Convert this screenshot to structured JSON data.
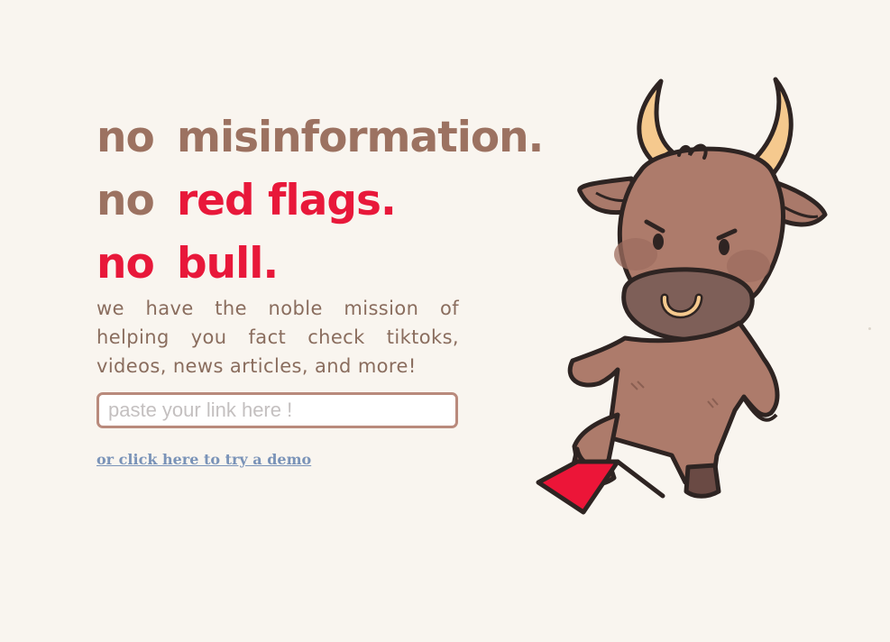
{
  "hero": {
    "line1": {
      "prefix": "no",
      "text": "misinformation."
    },
    "line2": {
      "prefix": "no",
      "text": "red flags."
    },
    "line3": {
      "prefix": "no",
      "text": "bull."
    },
    "mission": "we have the noble mission of helping you fact check tiktoks, videos, news articles, and more!"
  },
  "search": {
    "placeholder": "paste your link here !",
    "value": ""
  },
  "demo_link": "or click here to try a demo",
  "mascot": {
    "icon": "bull-mascot-icon",
    "holds": "red-flag-icon"
  },
  "colors": {
    "background": "#f9f5ef",
    "brown": "#9c7261",
    "red": "#e8183a",
    "link": "#7a93b8",
    "input_border": "#b98a7c"
  }
}
